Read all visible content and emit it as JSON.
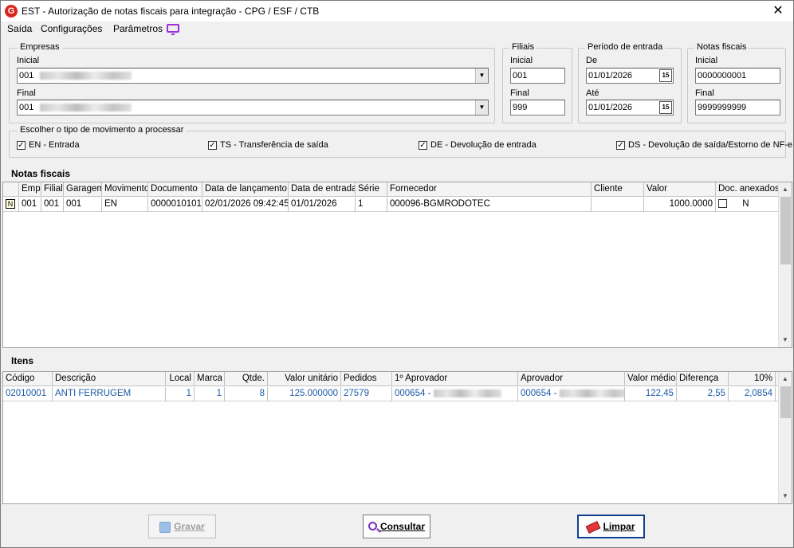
{
  "window": {
    "title": "EST - Autorização de notas fiscais para integração - CPG / ESF / CTB",
    "app_icon_letter": "G",
    "close_glyph": "✕"
  },
  "menu": {
    "items": [
      "Saída",
      "Configurações",
      "Parâmetros"
    ]
  },
  "empresas": {
    "legend": "Empresas",
    "inicial_label": "Inicial",
    "inicial_value": "001",
    "final_label": "Final",
    "final_value": "001"
  },
  "filiais": {
    "legend": "Filiais",
    "inicial_label": "Inicial",
    "inicial_value": "001",
    "final_label": "Final",
    "final_value": "999"
  },
  "periodo": {
    "legend": "Período de entrada",
    "de_label": "De",
    "de_value": "01/01/2026",
    "ate_label": "Até",
    "ate_value": "01/01/2026",
    "cal_glyph": "15"
  },
  "notas_range": {
    "legend": "Notas fiscais",
    "inicial_label": "Inicial",
    "inicial_value": "0000000001",
    "final_label": "Final",
    "final_value": "9999999999"
  },
  "movimento": {
    "legend": "Escolher o tipo de movimento a processar",
    "options": [
      {
        "label": "EN - Entrada",
        "checked": true
      },
      {
        "label": "TS - Transferência de saída",
        "checked": true
      },
      {
        "label": "DE - Devolução de entrada",
        "checked": true
      },
      {
        "label": "DS - Devolução de saída/Estorno de NF-e",
        "checked": true
      }
    ]
  },
  "notas_grid": {
    "title": "Notas fiscais",
    "columns": [
      "",
      "Emp",
      "Filial",
      "Garagem",
      "Movimento",
      "Documento",
      "Data de lançamento",
      "Data de entrada",
      "Série",
      "Fornecedor",
      "Cliente",
      "Valor",
      "Doc. anexados"
    ],
    "rows": [
      {
        "sel": "N",
        "emp": "001",
        "filial": "001",
        "garagem": "001",
        "movimento": "EN",
        "documento": "0000010101",
        "data_lanc": "02/01/2026 09:42:45",
        "data_entrada": "01/01/2026",
        "serie": "1",
        "fornecedor": "000096-BGMRODOTEC",
        "cliente": "",
        "valor": "1000.0000",
        "doc_anexados": "N"
      }
    ]
  },
  "itens_grid": {
    "title": "Itens",
    "columns": [
      "Código",
      "Descrição",
      "Local",
      "Marca",
      "Qtde.",
      "Valor unitário",
      "Pedidos",
      "1º Aprovador",
      "Aprovador",
      "Valor médio",
      "Diferença",
      "10%"
    ],
    "rows": [
      {
        "codigo": "02010001",
        "descricao": "ANTI FERRUGEM",
        "local": "1",
        "marca": "1",
        "qtde": "8",
        "valor_unitario": "125.000000",
        "pedidos": "27579",
        "aprovador1": "000654 -",
        "aprovador": "000654 -",
        "valor_medio": "122,45",
        "diferenca": "2,55",
        "pct": "2,0854"
      }
    ]
  },
  "buttons": {
    "gravar": "Gravar",
    "consultar": "Consultar",
    "limpar": "Limpar"
  },
  "colors": {
    "accent_blue": "#1c5ba8",
    "primary_border": "#0f3f8f",
    "app_red": "#d9261c",
    "monitor_purple": "#9b30d9"
  }
}
